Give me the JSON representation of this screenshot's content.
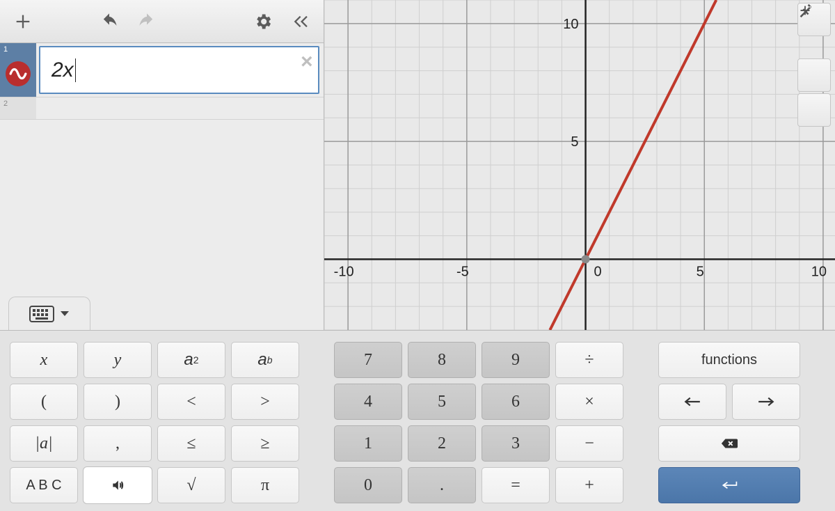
{
  "expressions": [
    {
      "index": "1",
      "content": "2x",
      "active": true,
      "has_wave_icon": true
    },
    {
      "index": "2",
      "content": "",
      "active": false,
      "has_wave_icon": false
    }
  ],
  "chart_data": {
    "type": "line",
    "title": "",
    "xlabel": "",
    "ylabel": "",
    "xlim": [
      -11,
      10.5
    ],
    "ylim": [
      -3,
      11
    ],
    "xticks": [
      -10,
      -5,
      0,
      5,
      10
    ],
    "yticks": [
      5,
      10
    ],
    "grid": true,
    "series": [
      {
        "name": "2x",
        "color": "#c0392b",
        "equation": "y = 2x",
        "points": [
          [
            -1.5,
            -3
          ],
          [
            5.5,
            11
          ]
        ]
      }
    ],
    "origin_dot": [
      0,
      0
    ]
  },
  "graph_buttons": {
    "wrench": "wrench",
    "zoom_in": "+",
    "zoom_out": "−"
  },
  "keyboard": {
    "left": [
      {
        "label": "x",
        "it": true
      },
      {
        "label": "y",
        "it": true
      },
      {
        "label": "a²",
        "sup": true,
        "base": "a",
        "exp": "2"
      },
      {
        "label": "aᵇ",
        "sup": true,
        "base": "a",
        "exp": "b",
        "expit": true
      },
      {
        "label": "("
      },
      {
        "label": ")"
      },
      {
        "label": "<"
      },
      {
        "label": ">"
      },
      {
        "label": "|a|",
        "it": true
      },
      {
        "label": ","
      },
      {
        "label": "≤"
      },
      {
        "label": "≥"
      },
      {
        "label": "A B C",
        "sans": true
      },
      {
        "label": "sound",
        "hl": true,
        "icon": "sound"
      },
      {
        "label": "√"
      },
      {
        "label": "π"
      }
    ],
    "mid": [
      {
        "label": "7",
        "dark": true
      },
      {
        "label": "8",
        "dark": true
      },
      {
        "label": "9",
        "dark": true
      },
      {
        "label": "÷"
      },
      {
        "label": "4",
        "dark": true
      },
      {
        "label": "5",
        "dark": true
      },
      {
        "label": "6",
        "dark": true
      },
      {
        "label": "×"
      },
      {
        "label": "1",
        "dark": true
      },
      {
        "label": "2",
        "dark": true
      },
      {
        "label": "3",
        "dark": true
      },
      {
        "label": "−"
      },
      {
        "label": "0",
        "dark": true
      },
      {
        "label": ".",
        "dark": true
      },
      {
        "label": "="
      },
      {
        "label": "+"
      }
    ],
    "right": [
      {
        "label": "functions",
        "wide": true,
        "sans": true
      },
      {
        "icon": "arrow-left"
      },
      {
        "icon": "arrow-right"
      },
      {
        "icon": "backspace",
        "wide": true
      },
      {
        "icon": "enter",
        "wide": true,
        "enter": true
      }
    ]
  }
}
